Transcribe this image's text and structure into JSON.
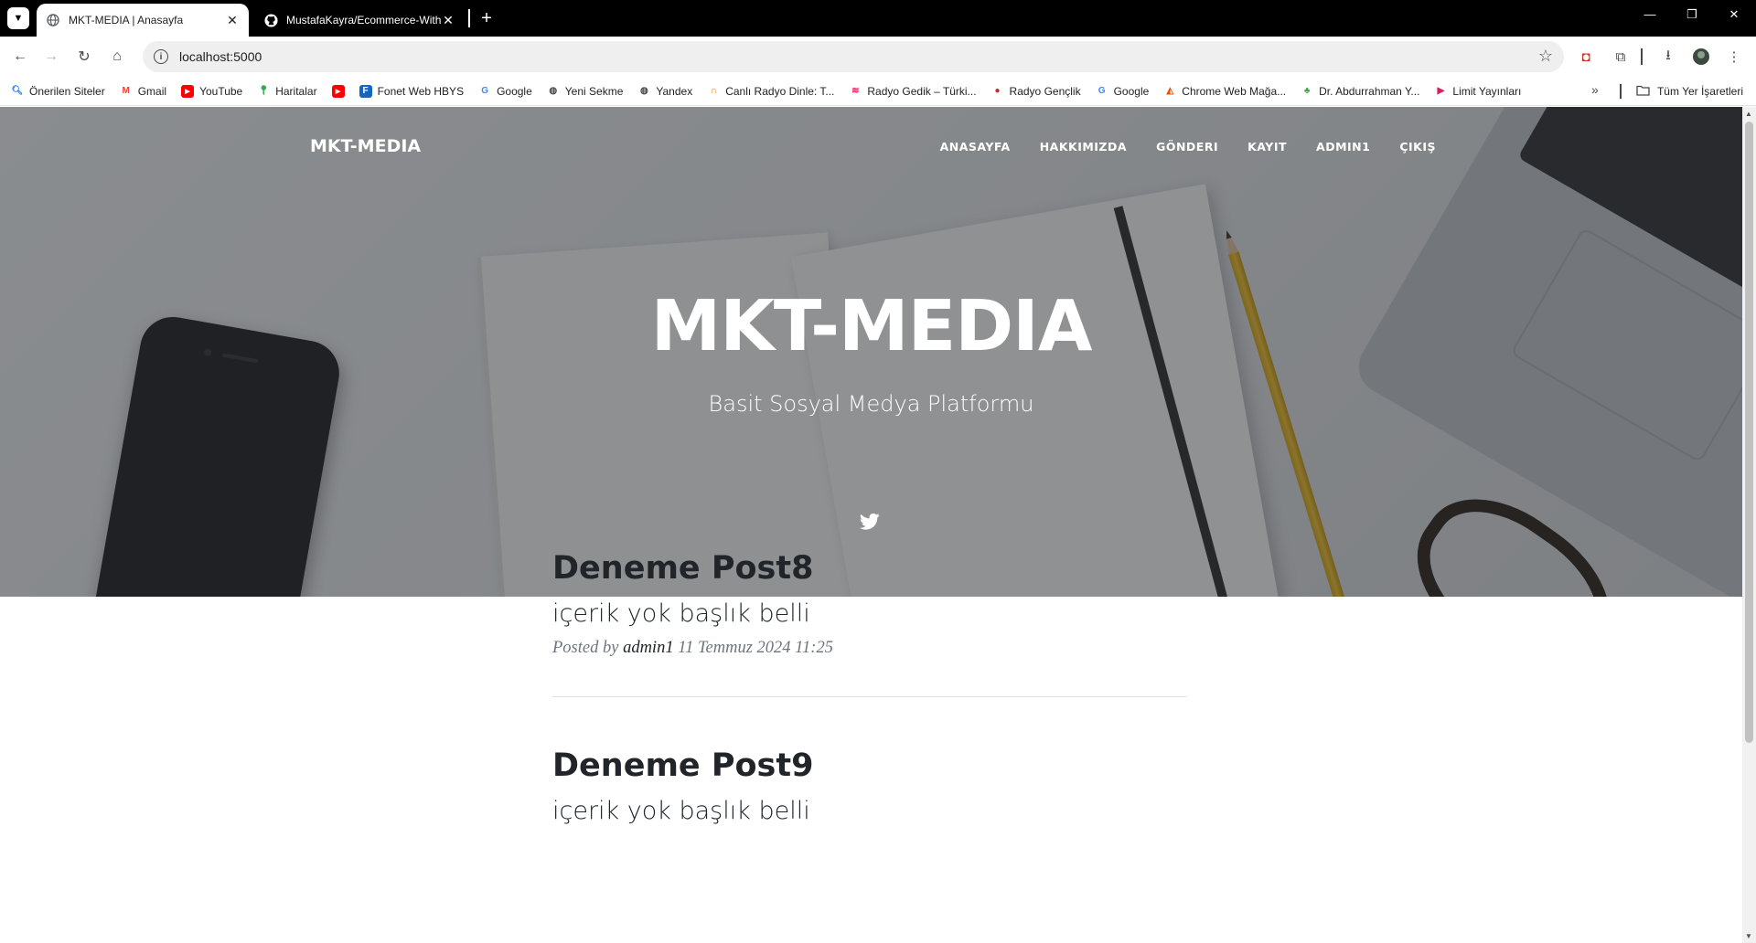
{
  "browser": {
    "tabs": [
      {
        "title": "MKT-MEDIA | Anasayfa",
        "active": true
      },
      {
        "title": "MustafaKayra/Ecommerce-With",
        "active": false
      }
    ],
    "url": "localhost:5000",
    "bookmarks": [
      {
        "label": "Önerilen Siteler",
        "icon": "search-icon",
        "color": "#1a73e8"
      },
      {
        "label": "Gmail",
        "icon": "gmail-icon",
        "color": "#ea4335"
      },
      {
        "label": "YouTube",
        "icon": "youtube-icon",
        "color": "#ff0000"
      },
      {
        "label": "Haritalar",
        "icon": "maps-icon",
        "color": "#34a853"
      },
      {
        "label": "",
        "icon": "youtube-icon",
        "color": "#ff0000"
      },
      {
        "label": "Fonet Web HBYS",
        "icon": "fonet-icon",
        "color": "#1565c0"
      },
      {
        "label": "Google",
        "icon": "google-icon",
        "color": "#4285f4"
      },
      {
        "label": "Yeni Sekme",
        "icon": "globe-icon",
        "color": "#474747"
      },
      {
        "label": "Yandex",
        "icon": "globe-icon",
        "color": "#474747"
      },
      {
        "label": "Canlı Radyo Dinle: T...",
        "icon": "headphones-icon",
        "color": "#f57c00"
      },
      {
        "label": "Radyo Gedik – Türki...",
        "icon": "radio-icon",
        "color": "#e91e63"
      },
      {
        "label": "Radyo Gençlik",
        "icon": "radio-icon",
        "color": "#c62828"
      },
      {
        "label": "Google",
        "icon": "google-icon",
        "color": "#4285f4"
      },
      {
        "label": "Chrome Web Mağa...",
        "icon": "chrome-store-icon",
        "color": "#e65100"
      },
      {
        "label": "Dr. Abdurrahman Y...",
        "icon": "tree-icon",
        "color": "#43a047"
      },
      {
        "label": "Limit Yayınları",
        "icon": "limit-icon",
        "color": "#d81b60"
      }
    ],
    "all_bookmarks": "Tüm Yer İşaretleri"
  },
  "site": {
    "brand": "MKT-MEDIA",
    "nav": [
      "ANASAYFA",
      "HAKKIMIZDA",
      "GÖNDERI",
      "KAYIT",
      "ADMIN1",
      "ÇIKIŞ"
    ],
    "hero_title": "MKT-MEDIA",
    "hero_subtitle": "Basit Sosyal Medya Platformu",
    "social": "twitter-icon"
  },
  "posts": [
    {
      "title": "Deneme Post8",
      "subtitle": "içerik yok başlık belli",
      "posted_by": "Posted by",
      "author": "admin1",
      "date": "11 Temmuz 2024 11:25"
    },
    {
      "title": "Deneme Post9",
      "subtitle": "içerik yok başlık belli"
    }
  ]
}
